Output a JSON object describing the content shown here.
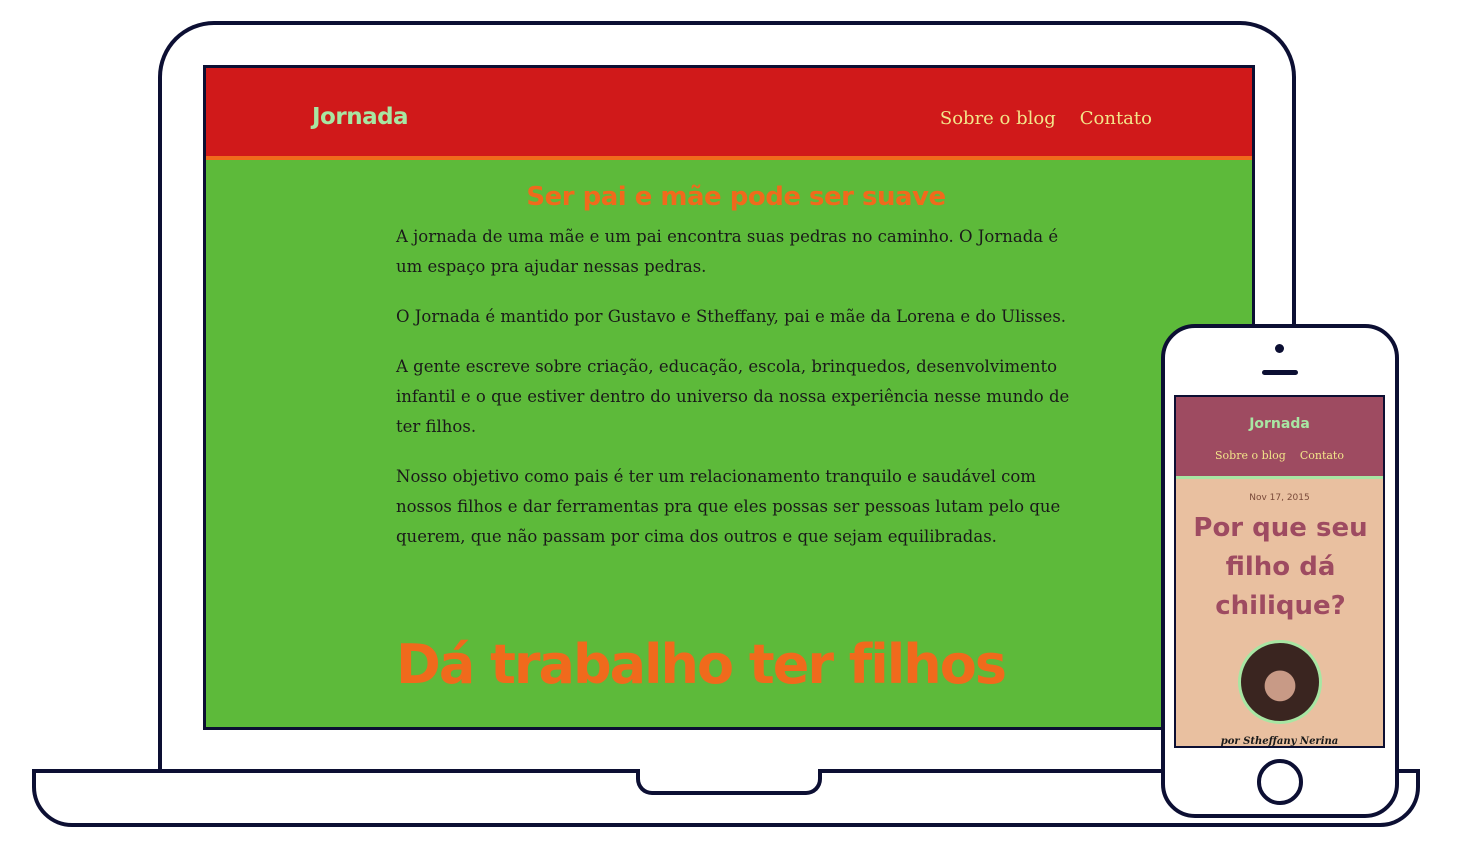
{
  "desktop": {
    "brand": "Jornada",
    "nav": [
      "Sobre o blog",
      "Contato"
    ],
    "headline": "Ser pai e mãe pode ser suave",
    "paragraphs": [
      "A jornada de uma mãe e um pai encontra suas pedras no caminho. O Jornada é um espaço pra ajudar nessas pedras.",
      "O Jornada é mantido por Gustavo e Stheffany, pai e mãe da Lorena e do Ulisses.",
      "A gente escreve sobre criação, educação, escola, brinquedos, desenvolvimento infantil e o que estiver dentro do universo da nossa experiência nesse mundo de ter filhos.",
      "Nosso objetivo como pais é ter um relacionamento tranquilo e saudável com nossos filhos e dar ferramentas pra que eles possas ser pessoas lutam pelo que querem, que não passam por cima dos outros e que sejam equilibradas."
    ],
    "big_heading": "Dá trabalho ter filhos"
  },
  "mobile": {
    "brand": "Jornada",
    "nav": [
      "Sobre o blog",
      "Contato"
    ],
    "date": "Nov 17, 2015",
    "title": "Por que seu filho dá chilique?",
    "author": "por Stheffany Nerina"
  },
  "colors": {
    "desktop_header": "#d0191a",
    "desktop_bg": "#5dba3a",
    "accent_orange": "#f06a1c",
    "brand_green": "#a8e6a3",
    "nav_yellow": "#f3e58a",
    "mobile_header": "#9e4b61",
    "mobile_bg": "#e9c0a0"
  },
  "icons": [
    "avatar-photo"
  ]
}
